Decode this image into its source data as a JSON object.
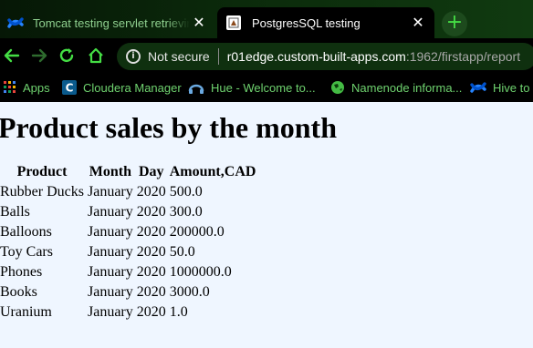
{
  "browser": {
    "tabs": [
      {
        "title": "Tomcat testing servlet retrieving d",
        "close": "✕",
        "favicon": "confluence-icon"
      },
      {
        "title": "PostgresSQL testing",
        "close": "✕",
        "favicon": "postgres-page-icon"
      }
    ],
    "new_tab": "+",
    "security_label": "Not secure",
    "url_host": "r01edge.custom-built-apps.com",
    "url_rest": ":1962/firstapp/report",
    "bookmarks": [
      {
        "label": "Apps",
        "icon": "apps-grid-icon"
      },
      {
        "label": "Cloudera Manager",
        "icon": "cloudera-icon"
      },
      {
        "label": "Hue - Welcome to...",
        "icon": "hue-icon"
      },
      {
        "label": "Namenode informa...",
        "icon": "globe-icon"
      },
      {
        "label": "Hive to Phoe",
        "icon": "confluence-icon"
      }
    ],
    "colors": {
      "accent": "#44dd44",
      "bookmark_text": "#6fd36f",
      "page_bg": "#eff6ff"
    }
  },
  "page": {
    "title": "Product sales by the month",
    "columns": [
      "Product",
      "Month",
      "Day",
      "Amount,CAD"
    ],
    "rows": [
      [
        "Rubber Ducks",
        "January",
        "2020",
        "500.0"
      ],
      [
        "Balls",
        "January",
        "2020",
        "300.0"
      ],
      [
        "Balloons",
        "January",
        "2020",
        "200000.0"
      ],
      [
        "Toy Cars",
        "January",
        "2020",
        "50.0"
      ],
      [
        "Phones",
        "January",
        "2020",
        "1000000.0"
      ],
      [
        "Books",
        "January",
        "2020",
        "3000.0"
      ],
      [
        "Uranium",
        "January",
        "2020",
        "1.0"
      ]
    ]
  }
}
